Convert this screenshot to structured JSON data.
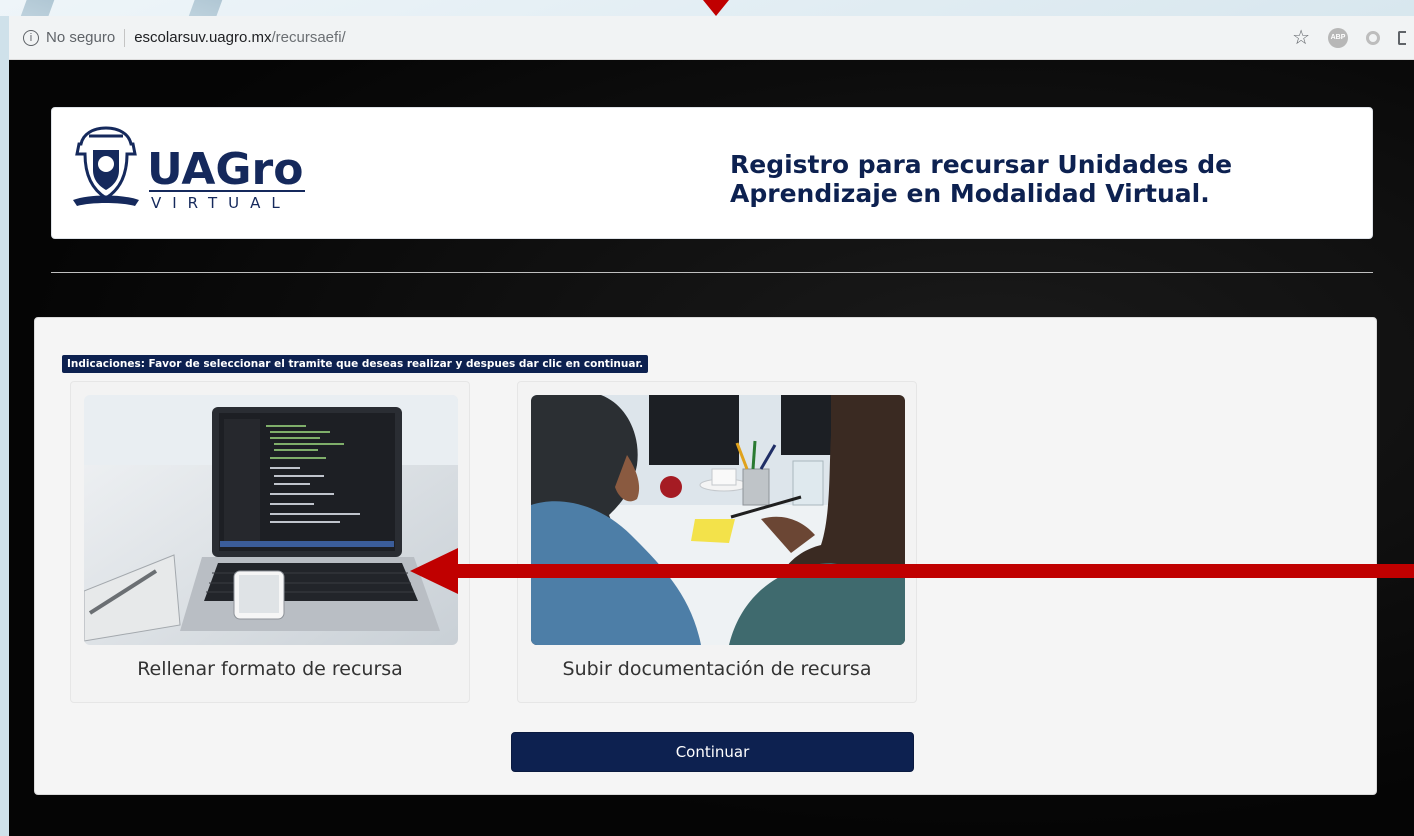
{
  "colors": {
    "brand_navy": "#0d2150",
    "annotation_red": "#c00000",
    "page_bg": "#0b0b0b"
  },
  "browser": {
    "security_label": "No seguro",
    "url_host": "escolarsuv.uagro.mx",
    "url_path": "/recursaefi/",
    "icons": [
      "info-icon",
      "star-icon",
      "adblock-icon",
      "extension-icon",
      "cast-icon"
    ]
  },
  "header": {
    "logo_word": "UAGro",
    "logo_sub": "VIRTUAL",
    "title": "Registro para recursar Unidades de Aprendizaje en Modalidad Virtual."
  },
  "main": {
    "instructions": "Indicaciones: Favor de seleccionar el tramite que deseas realizar y despues dar clic en continuar.",
    "options": [
      {
        "label": "Rellenar formato de recursa",
        "image": "laptop-with-code-photo"
      },
      {
        "label": "Subir documentación de recursa",
        "image": "people-at-desk-photo"
      }
    ],
    "continue_label": "Continuar"
  }
}
